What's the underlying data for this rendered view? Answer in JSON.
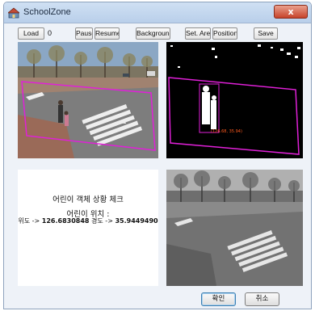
{
  "window": {
    "title": "SchoolZone",
    "close_label": "x"
  },
  "toolbar": {
    "load_label": "Load",
    "frame_value": "0",
    "pause_label": "Pause",
    "resume_label": "Resume",
    "background_label": "Background",
    "set_area_label": "Set. Area",
    "position_label": "Position",
    "save_label": "Save"
  },
  "detection": {
    "readout": "(126.68, 35.94)"
  },
  "info": {
    "title": "어린이 객체 상황 체크",
    "position_label": "어린이 위치 :",
    "lon_label": "위도 -> ",
    "lon_value": "126.6830848",
    "lat_label": " 경도 -> ",
    "lat_value": "35.9449490"
  },
  "dialog": {
    "ok_label": "확인",
    "cancel_label": "취소"
  },
  "colors": {
    "zone_outline": "#e020d8",
    "readout": "#ff5a1e",
    "accent": "#3c7fb1"
  }
}
